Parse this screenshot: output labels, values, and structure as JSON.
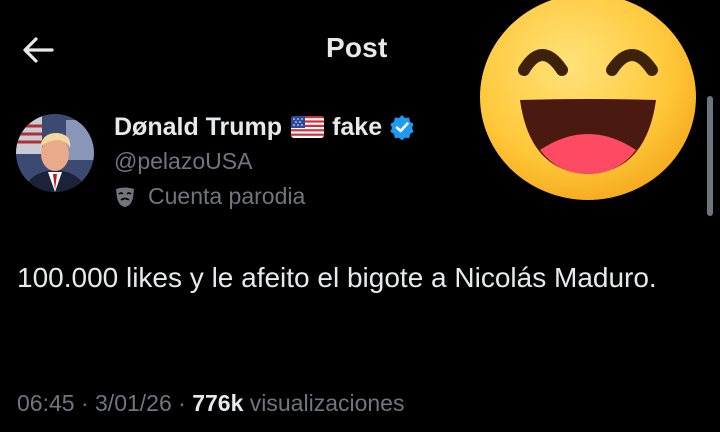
{
  "header": {
    "title": "Post",
    "back_icon": "arrow-left-icon"
  },
  "author": {
    "name": "Dønald Trump",
    "flag_icon": "us-flag-icon",
    "suffix": "fake",
    "verified_icon": "verified-badge-icon",
    "handle": "@pelazoUSA",
    "label_icon": "theater-mask-icon",
    "label": "Cuenta parodia"
  },
  "tweet": {
    "text": "100.000 likes y le afeito el bigote a Nicolás Maduro.",
    "time": "06:45",
    "date": "3/01/26",
    "views_count": "776k",
    "views_label": "visualizaciones"
  },
  "overlay": {
    "emoji_icon": "grinning-face-emoji"
  },
  "colors": {
    "background": "#000000",
    "primary_text": "#e7e9ea",
    "secondary_text": "#71767b",
    "verified": "#1d9bf0"
  }
}
